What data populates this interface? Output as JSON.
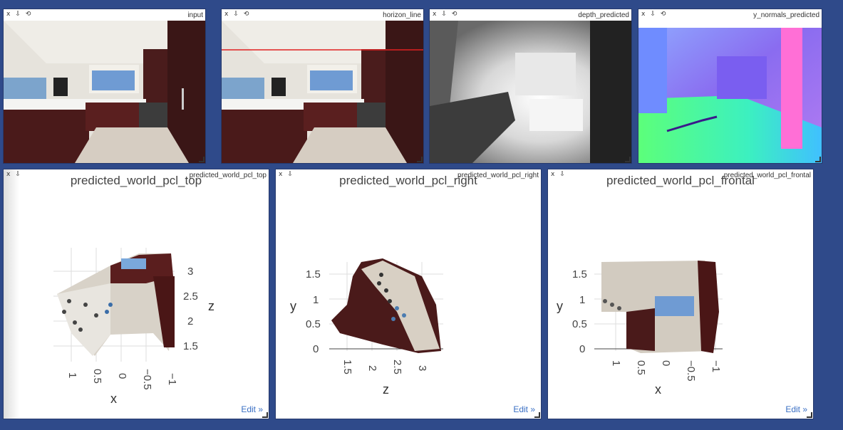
{
  "controls": {
    "close": "x",
    "download": "⇩",
    "reset": "⟲"
  },
  "panes": {
    "input": {
      "title": "input"
    },
    "horizon": {
      "title": "horizon_line"
    },
    "depth": {
      "title": "depth_predicted"
    },
    "normals": {
      "title": "y_normals_predicted"
    },
    "top": {
      "title": "predicted_world_pcl_top",
      "heading": "predicted_world_pcl_top",
      "edit": "Edit »",
      "axes": {
        "x_label": "x",
        "z_label": "z",
        "x_ticks": [
          "1",
          "0.5",
          "0",
          "−0.5",
          "−1"
        ],
        "z_ticks": [
          "3",
          "2.5",
          "2",
          "1.5"
        ]
      }
    },
    "right": {
      "title": "predicted_world_pcl_right",
      "heading": "predicted_world_pcl_right",
      "edit": "Edit »",
      "axes": {
        "y_label": "y",
        "z_label": "z",
        "y_ticks": [
          "1.5",
          "1",
          "0.5",
          "0"
        ],
        "z_ticks": [
          "1.5",
          "2",
          "2.5",
          "3"
        ]
      }
    },
    "frontal": {
      "title": "predicted_world_pcl_frontal",
      "heading": "predicted_world_pcl_frontal",
      "edit": "Edit »",
      "axes": {
        "y_label": "y",
        "x_label": "x",
        "y_ticks": [
          "1.5",
          "1",
          "0.5",
          "0"
        ],
        "x_ticks": [
          "1",
          "0.5",
          "0",
          "−0.5",
          "−1"
        ]
      }
    }
  }
}
